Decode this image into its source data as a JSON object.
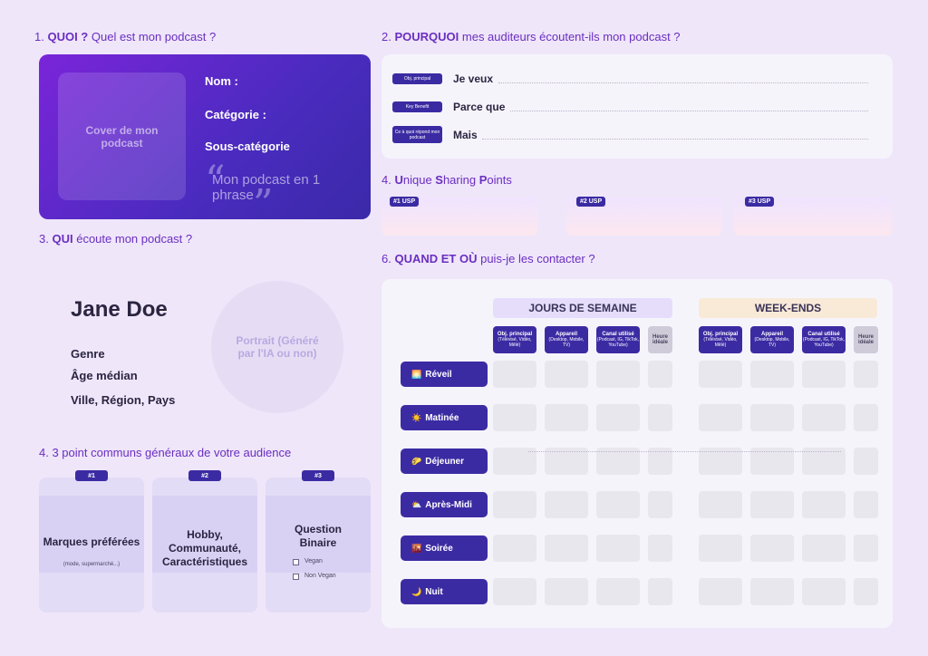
{
  "sections": {
    "s1": {
      "num": "1.",
      "key": "QUOI ?",
      "rest": "Quel est mon podcast ?"
    },
    "s2": {
      "num": "2.",
      "key": "POURQUOI",
      "rest": "mes auditeurs écoutent-ils mon podcast ?"
    },
    "s3": {
      "num": "3.",
      "key": "QUI",
      "rest": "écoute mon podcast ?"
    },
    "s4a": {
      "num": "4.",
      "u": "U",
      "p1": "nique ",
      "s": "S",
      "p2": "haring ",
      "pp": "P",
      "p3": "oints"
    },
    "s4b": {
      "text": "4. 3 point communs généraux de votre audience"
    },
    "s6": {
      "num": "6.",
      "key": "QUAND ET OÙ",
      "rest": "puis-je les contacter ?"
    }
  },
  "podcast": {
    "cover": "Cover de mon podcast",
    "nom": "Nom :",
    "categorie": "Catégorie :",
    "sous_categorie": "Sous-catégorie",
    "phrase": "Mon podcast en 1 phrase",
    "quote_open": "“",
    "quote_close": "”"
  },
  "why": [
    {
      "tag": "Obj. principal",
      "label": "Je veux"
    },
    {
      "tag": "Key Benefit",
      "label": "Parce que"
    },
    {
      "tag": "Ce à quoi répond mon podcast",
      "label": "Mais"
    }
  ],
  "usp": [
    "#1 USP",
    "#2 USP",
    "#3 USP"
  ],
  "persona": {
    "name": "Jane Doe",
    "genre": "Genre",
    "age": "Âge médian",
    "ville": "Ville, Région, Pays",
    "portrait": "Portrait (Généré par l'IA ou non)"
  },
  "common_points": [
    {
      "tag": "#1",
      "title": "Marques préférées",
      "sub": "(mode, supermarché...)"
    },
    {
      "tag": "#2",
      "title": "Hobby, Communauté, Caractéristiques",
      "sub": ""
    },
    {
      "tag": "#3",
      "title": "Question Binaire",
      "sub": "",
      "options": [
        "Vegan",
        "Non Vegan"
      ]
    }
  ],
  "schedule": {
    "weekday": "JOURS DE SEMAINE",
    "weekend": "WEEK-ENDS",
    "columns": [
      {
        "title": "Obj. principal",
        "sub": "(Télévisé, Vidéo, Mêlé)"
      },
      {
        "title": "Appareil",
        "sub": "(Desktop, Mobile, TV)"
      },
      {
        "title": "Canal utilisé",
        "sub": "(Podcast, IG, TikTok, YouTube)"
      },
      {
        "title": "Heure idéale",
        "sub": ""
      }
    ],
    "rows": [
      {
        "icon": "🌅",
        "label": "Réveil"
      },
      {
        "icon": "☀️",
        "label": "Matinée"
      },
      {
        "icon": "🌮",
        "label": "Déjeuner"
      },
      {
        "icon": "⛅",
        "label": "Après-Midi"
      },
      {
        "icon": "🌇",
        "label": "Soirée"
      },
      {
        "icon": "🌙",
        "label": "Nuit"
      }
    ]
  },
  "colors": {
    "accent": "#6a2fc0",
    "dark_tag": "#3b2ba3",
    "background": "#efe6fa"
  }
}
